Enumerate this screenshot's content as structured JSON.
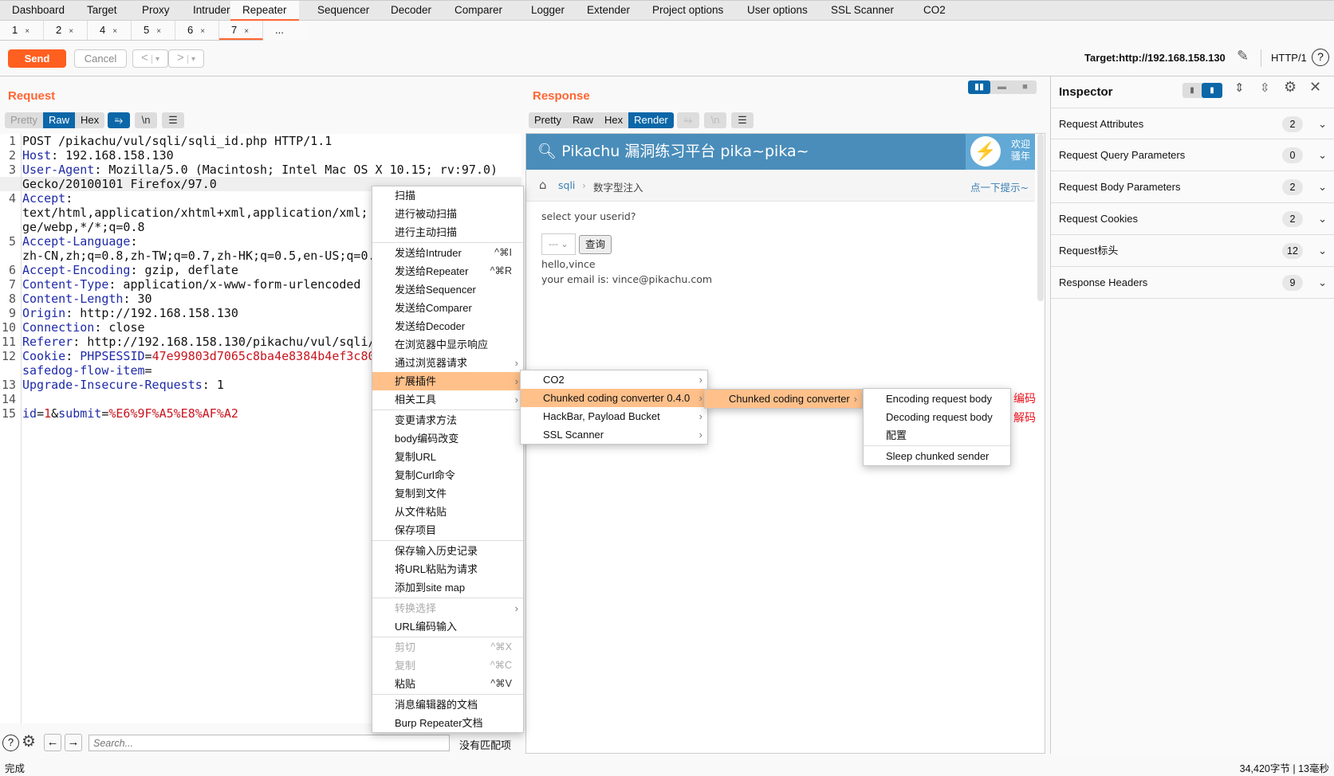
{
  "main_tabs": {
    "items": [
      "Dashboard",
      "Target",
      "Proxy",
      "Intruder",
      "Repeater",
      "Sequencer",
      "Decoder",
      "Comparer",
      "Logger",
      "Extender",
      "Project options",
      "User options",
      "SSL Scanner",
      "CO2"
    ],
    "active": "Repeater"
  },
  "repeater_tabs": {
    "items": [
      "1",
      "2",
      "4",
      "5",
      "6",
      "7"
    ],
    "active": "7",
    "more": "...",
    "close_glyph": "×"
  },
  "toolbar": {
    "send": "Send",
    "cancel": "Cancel",
    "back": "<",
    "forward": ">",
    "dropdown": "▾",
    "target": "Target:http://192.168.158.130",
    "protocol": "HTTP/1"
  },
  "request": {
    "title": "Request",
    "views": [
      "Pretty",
      "Raw",
      "Hex"
    ],
    "active_view": "Raw",
    "newline_btn": "\\n",
    "lines": [
      {
        "n": "1",
        "segs": [
          [
            "v",
            "POST /pikachu/vul/sqli/sqli_id.php HTTP/1.1"
          ]
        ]
      },
      {
        "n": "2",
        "segs": [
          [
            "k",
            "Host"
          ],
          [
            "v",
            ": 192.168.158.130"
          ]
        ]
      },
      {
        "n": "3",
        "segs": [
          [
            "k",
            "User-Agent"
          ],
          [
            "v",
            ": Mozilla/5.0 (Macintosh; Intel Mac OS X 10.15; rv:97.0)"
          ]
        ]
      },
      {
        "n": "",
        "segs": [
          [
            "v",
            "Gecko/20100101 Firefox/97.0"
          ]
        ],
        "hl": true
      },
      {
        "n": "4",
        "segs": [
          [
            "k",
            "Accept"
          ],
          [
            "v",
            ":"
          ]
        ]
      },
      {
        "n": "",
        "segs": [
          [
            "v",
            "text/html,application/xhtml+xml,application/xml;"
          ]
        ]
      },
      {
        "n": "",
        "segs": [
          [
            "v",
            "ge/webp,*/*;q=0.8"
          ]
        ]
      },
      {
        "n": "5",
        "segs": [
          [
            "k",
            "Accept-Language"
          ],
          [
            "v",
            ":"
          ]
        ]
      },
      {
        "n": "",
        "segs": [
          [
            "v",
            "zh-CN,zh;q=0.8,zh-TW;q=0.7,zh-HK;q=0.5,en-US;q=0."
          ]
        ]
      },
      {
        "n": "6",
        "segs": [
          [
            "k",
            "Accept-Encoding"
          ],
          [
            "v",
            ": gzip, deflate"
          ]
        ]
      },
      {
        "n": "7",
        "segs": [
          [
            "k",
            "Content-Type"
          ],
          [
            "v",
            ": application/x-www-form-urlencoded"
          ]
        ]
      },
      {
        "n": "8",
        "segs": [
          [
            "k",
            "Content-Length"
          ],
          [
            "v",
            ": 30"
          ]
        ]
      },
      {
        "n": "9",
        "segs": [
          [
            "k",
            "Origin"
          ],
          [
            "v",
            ": http://192.168.158.130"
          ]
        ]
      },
      {
        "n": "10",
        "segs": [
          [
            "k",
            "Connection"
          ],
          [
            "v",
            ": close"
          ]
        ]
      },
      {
        "n": "11",
        "segs": [
          [
            "k",
            "Referer"
          ],
          [
            "v",
            ": http://192.168.158.130/pikachu/vul/sqli/"
          ]
        ]
      },
      {
        "n": "12",
        "segs": [
          [
            "k",
            "Cookie"
          ],
          [
            "v",
            ": "
          ],
          [
            "k",
            "PHPSESSID"
          ],
          [
            "v",
            "="
          ],
          [
            "r",
            "47e99803d7065c8ba4e8384b4ef3c80"
          ]
        ]
      },
      {
        "n": "",
        "segs": [
          [
            "k",
            "safedog-flow-item"
          ],
          [
            "v",
            "="
          ]
        ]
      },
      {
        "n": "13",
        "segs": [
          [
            "k",
            "Upgrade-Insecure-Requests"
          ],
          [
            "v",
            ": 1"
          ]
        ]
      },
      {
        "n": "14",
        "segs": []
      },
      {
        "n": "15",
        "segs": [
          [
            "k",
            "id"
          ],
          [
            "v",
            "="
          ],
          [
            "r",
            "1"
          ],
          [
            "v",
            "&"
          ],
          [
            "k",
            "submit"
          ],
          [
            "v",
            "="
          ],
          [
            "r",
            "%E6%9F%A5%E8%AF%A2"
          ]
        ]
      }
    ]
  },
  "response": {
    "title": "Response",
    "views": [
      "Pretty",
      "Raw",
      "Hex",
      "Render"
    ],
    "active_view": "Render",
    "newline_btn": "\\n",
    "render": {
      "site_title": "Pikachu 漏洞练习平台 pika~pika~",
      "welcome": "欢迎",
      "welcome2": "骚年",
      "crumb_link": "sqli",
      "crumb_current": "数字型注入",
      "hint": "点一下提示~",
      "prompt": "select your userid?",
      "select_value": "---",
      "query_button": "查询",
      "hello": "hello,vince",
      "email": "your email is: vince@pikachu.com"
    }
  },
  "inspector": {
    "title": "Inspector",
    "rows": [
      {
        "label": "Request Attributes",
        "count": "2"
      },
      {
        "label": "Request Query Parameters",
        "count": "0"
      },
      {
        "label": "Request Body Parameters",
        "count": "2"
      },
      {
        "label": "Request Cookies",
        "count": "2"
      },
      {
        "label": "Request标头",
        "count": "12"
      },
      {
        "label": "Response Headers",
        "count": "9"
      }
    ]
  },
  "context_menu": {
    "groups": [
      [
        {
          "label": "扫描"
        },
        {
          "label": "进行被动扫描"
        },
        {
          "label": "进行主动扫描"
        }
      ],
      [
        {
          "label": "发送给Intruder",
          "shortcut": "^⌘I"
        },
        {
          "label": "发送给Repeater",
          "shortcut": "^⌘R"
        },
        {
          "label": "发送给Sequencer"
        },
        {
          "label": "发送给Comparer"
        },
        {
          "label": "发送给Decoder"
        },
        {
          "label": "在浏览器中显示响应"
        },
        {
          "label": "通过浏览器请求",
          "submenu": true
        },
        {
          "label": "扩展插件",
          "submenu": true,
          "selected": true
        },
        {
          "label": "相关工具",
          "submenu": true
        }
      ],
      [
        {
          "label": "变更请求方法"
        },
        {
          "label": "body编码改变"
        },
        {
          "label": "复制URL"
        },
        {
          "label": "复制Curl命令"
        },
        {
          "label": "复制到文件"
        },
        {
          "label": "从文件粘贴"
        },
        {
          "label": "保存项目"
        }
      ],
      [
        {
          "label": "保存输入历史记录"
        },
        {
          "label": "将URL粘贴为请求"
        },
        {
          "label": "添加到site map"
        }
      ],
      [
        {
          "label": "转换选择",
          "submenu": true,
          "disabled": true
        },
        {
          "label": "URL编码输入"
        }
      ],
      [
        {
          "label": "剪切",
          "shortcut": "^⌘X",
          "disabled": true
        },
        {
          "label": "复制",
          "shortcut": "^⌘C",
          "disabled": true
        },
        {
          "label": "粘贴",
          "shortcut": "^⌘V"
        }
      ],
      [
        {
          "label": "消息编辑器的文档"
        },
        {
          "label": "Burp Repeater文档"
        }
      ]
    ]
  },
  "extensions_menu": {
    "groups": [
      [
        {
          "label": "CO2",
          "submenu": true
        },
        {
          "label": "Chunked coding converter 0.4.0",
          "submenu": true,
          "selected": true
        },
        {
          "label": "HackBar, Payload Bucket",
          "submenu": true
        },
        {
          "label": "SSL Scanner",
          "submenu": true
        }
      ]
    ]
  },
  "chunked_menu": {
    "groups": [
      [
        {
          "label": "Chunked coding converter",
          "submenu": true,
          "selected": true
        }
      ]
    ]
  },
  "chunked_actions_menu": {
    "groups": [
      [
        {
          "label": "Encoding request body"
        },
        {
          "label": "Decoding request body"
        },
        {
          "label": "配置"
        }
      ],
      [
        {
          "label": "Sleep chunked sender"
        }
      ]
    ]
  },
  "annotations": {
    "encode": "编码",
    "decode": "解码",
    "color": "#e8101a"
  },
  "search": {
    "placeholder": "Search...",
    "result": "没有匹配项"
  },
  "status": {
    "left": "完成",
    "right": "34,420字节 | 13毫秒"
  },
  "colors": {
    "accent": "#ff6633",
    "active_blue": "#0b67a8",
    "menu_highlight": "#ffc08a",
    "pikachu_header": "#4a8dba"
  }
}
